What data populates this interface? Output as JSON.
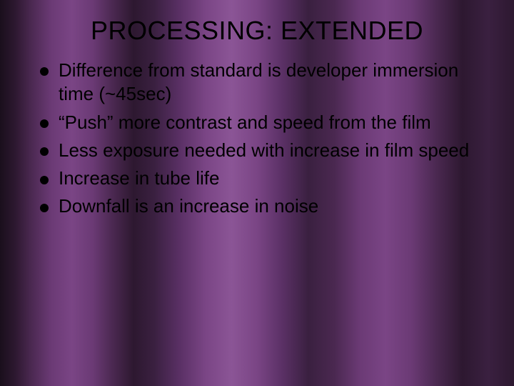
{
  "slide": {
    "title": "PROCESSING: EXTENDED",
    "bullets": [
      "Difference from standard is developer immersion time (~45sec)",
      "“Push” more contrast and speed from the film",
      "Less exposure needed with increase in film speed",
      "Increase in tube life",
      "Downfall is an increase in noise"
    ]
  }
}
